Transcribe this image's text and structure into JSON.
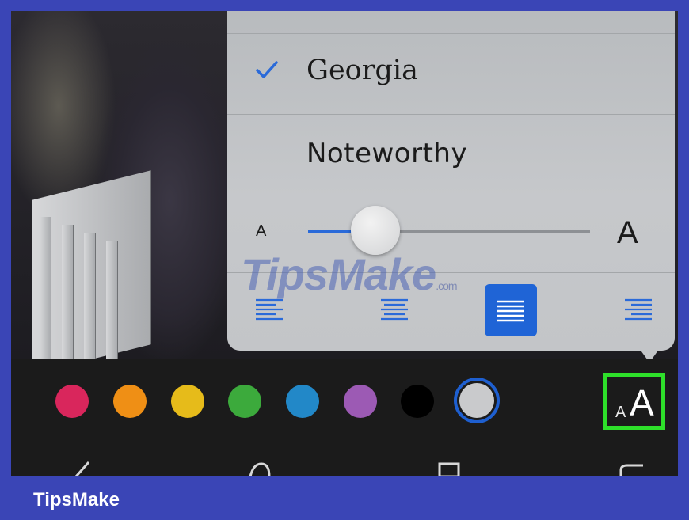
{
  "fonts": {
    "items": [
      {
        "label": "Georgia",
        "selected": true
      },
      {
        "label": "Noteworthy",
        "selected": false
      }
    ]
  },
  "text_size": {
    "small_label": "A",
    "large_label": "A",
    "level": 0.24
  },
  "alignment": {
    "options": [
      "align-left",
      "align-center",
      "align-justify",
      "align-right"
    ],
    "selected": "align-justify"
  },
  "colors": {
    "swatches": [
      "#d9265c",
      "#ef8f15",
      "#e6bb1a",
      "#3caa3c",
      "#2288c8",
      "#9c5ab4",
      "#000000",
      "#c9cacc"
    ],
    "selected": "#c9cacc",
    "accent": "#1f64d6",
    "highlight": "#2ee02a"
  },
  "text_style_button": {
    "small": "A",
    "large": "A"
  },
  "watermark": {
    "text": "TipsMake",
    "suffix": ".com"
  },
  "brand": "TipsMake"
}
